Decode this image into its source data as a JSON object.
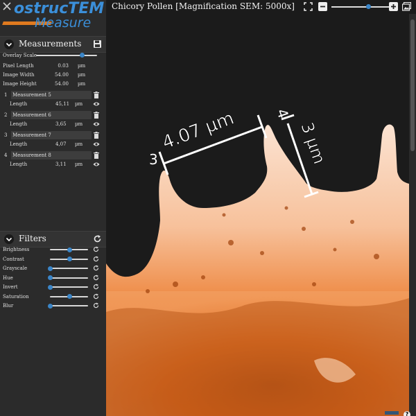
{
  "app": {
    "logo_line1": "ostrucTEM",
    "logo_line2": "Measure"
  },
  "measurements_panel": {
    "title": "Measurements",
    "overlay_scale_label": "Overlay Scale",
    "overlay_scale_value": 0.75,
    "props": [
      {
        "label": "Pixel Length",
        "value": "0.03",
        "unit": "µm"
      },
      {
        "label": "Image Width",
        "value": "54.00",
        "unit": "µm"
      },
      {
        "label": "Image Height",
        "value": "54.00",
        "unit": "µm"
      }
    ],
    "items": [
      {
        "num": "1",
        "name": "Measurement 5",
        "sub_label": "Length",
        "value": "45,11",
        "unit": "µm"
      },
      {
        "num": "2",
        "name": "Measurement 6",
        "sub_label": "Length",
        "value": "3,65",
        "unit": "µm"
      },
      {
        "num": "3",
        "name": "Measurement 7",
        "sub_label": "Length",
        "value": "4,07",
        "unit": "µm"
      },
      {
        "num": "4",
        "name": "Measurement 8",
        "sub_label": "Length",
        "value": "3,11",
        "unit": "µm"
      }
    ]
  },
  "filters_panel": {
    "title": "Filters",
    "items": [
      {
        "label": "Brightness",
        "value": 0.5
      },
      {
        "label": "Contrast",
        "value": 0.5
      },
      {
        "label": "Grayscale",
        "value": 0.0
      },
      {
        "label": "Hue",
        "value": 0.0
      },
      {
        "label": "Invert",
        "value": 0.0
      },
      {
        "label": "Saturation",
        "value": 0.5
      },
      {
        "label": "Blur",
        "value": 0.0
      }
    ]
  },
  "viewer": {
    "title": "Chicory Pollen [Magnification SEM: 5000x]",
    "zoom_value": 0.62,
    "overlay_measure_1_label": "4.07 µm",
    "overlay_measure_1_start": "3",
    "overlay_measure_2_label": "3 µm",
    "overlay_measure_2_start": "4",
    "help_label": "?"
  },
  "colors": {
    "accent": "#3b86c8",
    "sidebar_bg": "#2b2b2b",
    "image_orange": "#e0691c"
  }
}
